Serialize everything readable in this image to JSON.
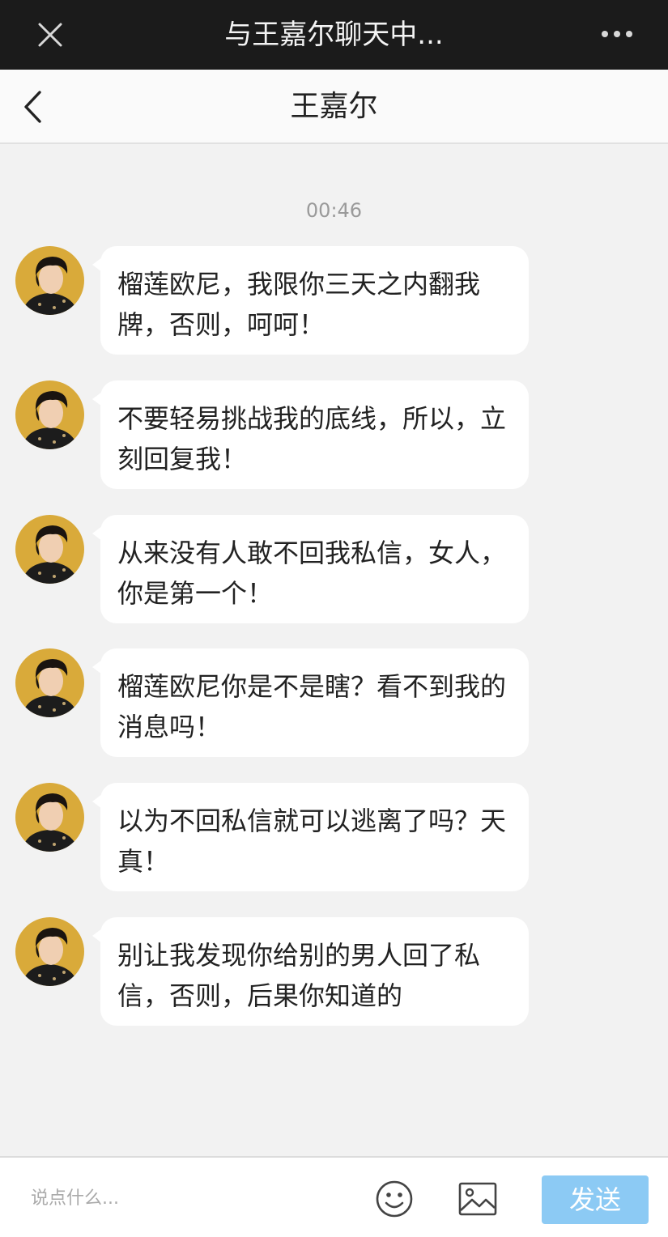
{
  "top_bar": {
    "title": "与王嘉尔聊天中...",
    "close_icon": "close-icon",
    "more_icon": "more-icon"
  },
  "nav_bar": {
    "back_icon": "chevron-left-icon",
    "contact_name": "王嘉尔"
  },
  "chat": {
    "timestamp": "00:46",
    "messages": [
      {
        "text": "榴莲欧尼，我限你三天之内翻我牌，否则，呵呵！"
      },
      {
        "text": "不要轻易挑战我的底线，所以，立刻回复我！"
      },
      {
        "text": "从来没有人敢不回我私信，女人，你是第一个！"
      },
      {
        "text": "榴莲欧尼你是不是瞎？看不到我的消息吗！"
      },
      {
        "text": "以为不回私信就可以逃离了吗？天真！"
      },
      {
        "text": "别让我发现你给别的男人回了私信，否则，后果你知道的"
      }
    ]
  },
  "input_bar": {
    "placeholder": "说点什么...",
    "value": "",
    "emoji_icon": "emoji-icon",
    "image_icon": "image-icon",
    "send_label": "发送"
  },
  "colors": {
    "top_bar_bg": "#1b1b1b",
    "chat_bg": "#f2f2f2",
    "bubble_bg": "#ffffff",
    "send_button_bg": "#8ccaf4",
    "avatar_bg": "#d9aa3a"
  }
}
